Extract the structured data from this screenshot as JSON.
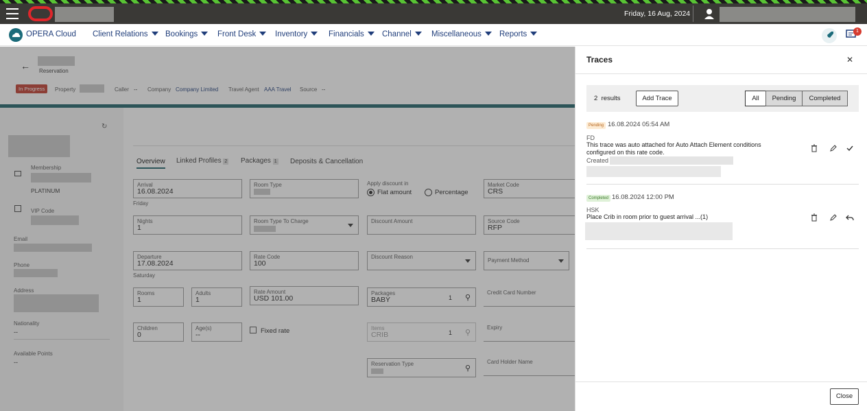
{
  "topbar": {
    "date": "Friday, 16 Aug, 2024"
  },
  "nav": {
    "app_name": "OPERA Cloud",
    "items": [
      {
        "label": "Client Relations"
      },
      {
        "label": "Bookings"
      },
      {
        "label": "Front Desk"
      },
      {
        "label": "Inventory"
      },
      {
        "label": "Financials"
      },
      {
        "label": "Channel"
      },
      {
        "label": "Miscellaneous"
      },
      {
        "label": "Reports"
      }
    ],
    "notification_count": "1"
  },
  "reservation": {
    "subtitle": "Reservation",
    "status": "In Progress",
    "property_label": "Property",
    "caller_label": "Caller",
    "caller_value": "--",
    "company_label": "Company",
    "company_value": "Company Limited",
    "travel_agent_label": "Travel Agent",
    "travel_agent_value": "AAA Travel",
    "source_label": "Source",
    "source_value": "--"
  },
  "profile": {
    "membership_label": "Membership",
    "membership_value": "PLATINUM",
    "vip_label": "VIP Code",
    "email_label": "Email",
    "phone_label": "Phone",
    "address_label": "Address",
    "nationality_label": "Nationality",
    "nationality_value": "--",
    "points_label": "Available Points",
    "points_value": "--"
  },
  "tabs": [
    {
      "label": "Overview"
    },
    {
      "label": "Linked Profiles",
      "count": "2"
    },
    {
      "label": "Packages",
      "count": "1"
    },
    {
      "label": "Deposits & Cancellation"
    }
  ],
  "form": {
    "arrival": {
      "label": "Arrival",
      "value": "16.08.2024",
      "day": "Friday"
    },
    "nights": {
      "label": "Nights",
      "value": "1"
    },
    "departure": {
      "label": "Departure",
      "value": "17.08.2024",
      "day": "Saturday"
    },
    "rooms": {
      "label": "Rooms",
      "value": "1"
    },
    "adults": {
      "label": "Adults",
      "value": "1"
    },
    "children": {
      "label": "Children",
      "value": "0"
    },
    "ages": {
      "label": "Age(s)",
      "value": "--"
    },
    "room_type": {
      "label": "Room Type"
    },
    "room_type_charge": {
      "label": "Room Type To Charge"
    },
    "rate_code": {
      "label": "Rate Code",
      "value": "100"
    },
    "rate_amount": {
      "label": "Rate Amount",
      "value": "USD 101.00"
    },
    "fixed_rate": {
      "label": "Fixed rate"
    },
    "discount_in": {
      "label": "Apply discount in",
      "flat": "Flat amount",
      "percentage": "Percentage"
    },
    "discount_amount": {
      "label": "Discount Amount"
    },
    "discount_reason": {
      "label": "Discount Reason"
    },
    "packages": {
      "label": "Packages",
      "value": "BABY",
      "count": "1"
    },
    "items": {
      "label": "Items",
      "value": "CRIB",
      "count": "1"
    },
    "reservation_type": {
      "label": "Reservation Type"
    },
    "market_code": {
      "label": "Market Code",
      "value": "CRS"
    },
    "source_code": {
      "label": "Source Code",
      "value": "RFP"
    },
    "payment_method": {
      "label": "Payment Method"
    },
    "cc_number": {
      "label": "Credit Card Number"
    },
    "expiry": {
      "label": "Expiry"
    },
    "card_holder": {
      "label": "Card Holder Name"
    }
  },
  "traces": {
    "title": "Traces",
    "results_count": "2",
    "results_label": "results",
    "add_button": "Add Trace",
    "filters": [
      {
        "label": "All"
      },
      {
        "label": "Pending"
      },
      {
        "label": "Completed"
      }
    ],
    "entries": [
      {
        "status": "Pending",
        "datetime": "16.08.2024 05:54 AM",
        "department": "FD",
        "text": "This trace was auto attached for Auto Attach Element conditions configured on this rate code.",
        "created_label": "Created"
      },
      {
        "status": "Completed",
        "datetime": "16.08.2024 12:00 PM",
        "department": "HSK",
        "text": "Place Crib in room prior to guest arrival ...(1)"
      }
    ],
    "close_button": "Close"
  },
  "colors": {
    "topbar": "#3a3936",
    "nav_text": "#1f3d7a",
    "status_red": "#c0392b",
    "teal_line": "#1b5f66",
    "pending_badge_bg": "#fdebd3",
    "completed_badge_bg": "#dff1d8"
  }
}
